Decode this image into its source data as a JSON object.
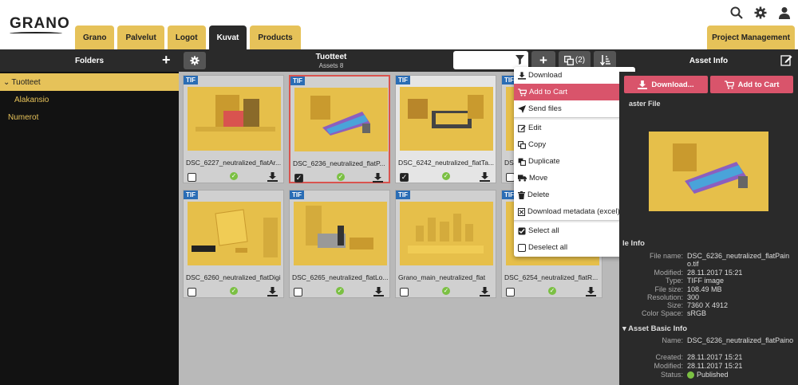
{
  "brand": {
    "logo_text": "GRANO"
  },
  "tabs": [
    {
      "label": "Grano"
    },
    {
      "label": "Palvelut"
    },
    {
      "label": "Logot"
    },
    {
      "label": "Kuvat"
    },
    {
      "label": "Products"
    }
  ],
  "project_tab": "Project Management",
  "toolbar": {
    "folders_title": "Folders",
    "gallery_title": "Tuotteet",
    "gallery_count": "Assets 8",
    "cart_count": "(2)",
    "asset_info_title": "Asset Info"
  },
  "folders": [
    {
      "label": "Tuotteet"
    },
    {
      "label": "Alakansio"
    },
    {
      "label": "Numerot"
    }
  ],
  "assets": [
    {
      "badge": "TIF",
      "name": "DSC_6227_neutralized_flatAr..."
    },
    {
      "badge": "TIF",
      "name": "DSC_6236_neutralized_flatP..."
    },
    {
      "badge": "TIF",
      "name": "DSC_6242_neutralized_flatTa..."
    },
    {
      "badge": "TIF",
      "name": "DS"
    },
    {
      "badge": "TIF",
      "name": "DSC_6260_neutralized_flatDigi"
    },
    {
      "badge": "TIF",
      "name": "DSC_6265_neutralized_flatLo..."
    },
    {
      "badge": "TIF",
      "name": "Grano_main_neutralized_flat"
    },
    {
      "badge": "TIF",
      "name": "DSC_6254_neutralized_flatR..."
    }
  ],
  "context_menu": [
    {
      "label": "Download"
    },
    {
      "label": "Add to Cart"
    },
    {
      "label": "Send files"
    },
    {
      "label": "Edit"
    },
    {
      "label": "Copy"
    },
    {
      "label": "Duplicate"
    },
    {
      "label": "Move"
    },
    {
      "label": "Delete"
    },
    {
      "label": "Download metadata (excel)"
    },
    {
      "label": "Select all"
    },
    {
      "label": "Deselect all"
    }
  ],
  "info": {
    "download_btn": "Download...",
    "cart_btn": "Add to Cart",
    "master_file": "aster File",
    "file_info_title": "le Info",
    "file_info": [
      {
        "k": "File name:",
        "v": "DSC_6236_neutralized_flatPaino.tif"
      },
      {
        "k": "Modified:",
        "v": "28.11.2017 15:21"
      },
      {
        "k": "Type:",
        "v": "TIFF image"
      },
      {
        "k": "File size:",
        "v": "108.49 MB"
      },
      {
        "k": "Resolution:",
        "v": "300"
      },
      {
        "k": "Size:",
        "v": "7360 X 4912"
      },
      {
        "k": "Color Space:",
        "v": "sRGB"
      }
    ],
    "basic_title": "Asset Basic Info",
    "basic": [
      {
        "k": "Name:",
        "v": "DSC_6236_neutralized_flatPaino"
      },
      {
        "k": "Created:",
        "v": "28.11.2017 15:21"
      },
      {
        "k": "Modified:",
        "v": "28.11.2017 15:21"
      },
      {
        "k": "Status:",
        "v": "Published"
      }
    ]
  }
}
